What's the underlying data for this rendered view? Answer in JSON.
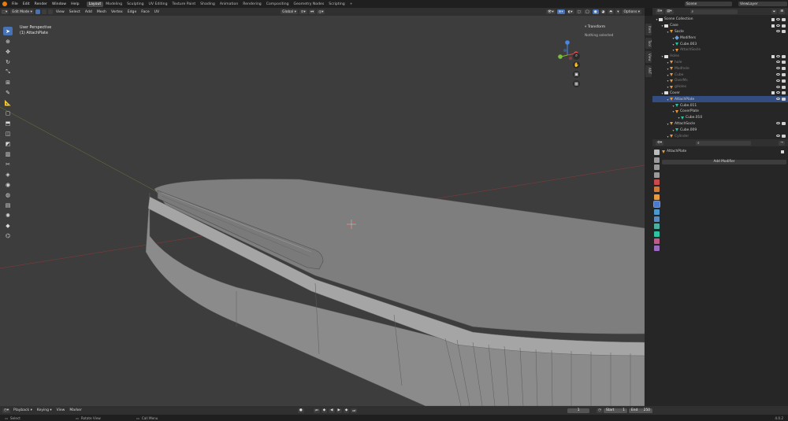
{
  "topmenu": {
    "items": [
      "File",
      "Edit",
      "Render",
      "Window",
      "Help"
    ],
    "workspaces": [
      "Layout",
      "Modeling",
      "Sculpting",
      "UV Editing",
      "Texture Paint",
      "Shading",
      "Animation",
      "Rendering",
      "Compositing",
      "Geometry Nodes",
      "Scripting"
    ],
    "active_workspace": "Layout",
    "add_tab": "+",
    "scene_label": "Scene",
    "viewlayer_label": "ViewLayer"
  },
  "viewport_header": {
    "mode": "Edit Mode",
    "menus": [
      "View",
      "Select",
      "Add",
      "Mesh",
      "Vertex",
      "Edge",
      "Face",
      "UV"
    ],
    "orientation": "Global",
    "options": "Options"
  },
  "viewport": {
    "perspective_label": "User Perspective",
    "object_label": "(1) AttachPlate",
    "transform_header": "Transform",
    "transform_status": "Nothing selected",
    "gizmo_axes": [
      "X",
      "Y",
      "Z"
    ]
  },
  "side_tabs": [
    "Item",
    "Tool",
    "View",
    "ANT"
  ],
  "outliner": {
    "search_placeholder": "",
    "rows": [
      {
        "label": "Scene Collection",
        "indent": 0,
        "icon": "coll",
        "state": "normal"
      },
      {
        "label": "Case",
        "indent": 1,
        "icon": "coll",
        "state": "normal"
      },
      {
        "label": "Socle",
        "indent": 2,
        "icon": "obj",
        "state": "normal"
      },
      {
        "label": "Modifiers",
        "indent": 3,
        "icon": "mod",
        "state": "normal"
      },
      {
        "label": "Cube.003",
        "indent": 3,
        "icon": "mesh",
        "state": "normal"
      },
      {
        "label": "AttachSocle",
        "indent": 3,
        "icon": "obj",
        "state": "dim"
      },
      {
        "label": "Holes",
        "indent": 1,
        "icon": "coll",
        "state": "dim"
      },
      {
        "label": "hole",
        "indent": 2,
        "icon": "obj",
        "state": "dim"
      },
      {
        "label": "Modhole",
        "indent": 2,
        "icon": "obj",
        "state": "dim"
      },
      {
        "label": "Cube",
        "indent": 2,
        "icon": "obj",
        "state": "dim"
      },
      {
        "label": "OverMs",
        "indent": 2,
        "icon": "obj",
        "state": "dim"
      },
      {
        "label": "gHoles",
        "indent": 2,
        "icon": "obj",
        "state": "dim"
      },
      {
        "label": "Cover",
        "indent": 1,
        "icon": "coll",
        "state": "normal"
      },
      {
        "label": "AttachPlate",
        "indent": 2,
        "icon": "obj",
        "state": "selected"
      },
      {
        "label": "Cube.011",
        "indent": 3,
        "icon": "mesh",
        "state": "normal"
      },
      {
        "label": "CoverPlate",
        "indent": 3,
        "icon": "obj",
        "state": "normal"
      },
      {
        "label": "Cube.010",
        "indent": 4,
        "icon": "mesh",
        "state": "normal"
      },
      {
        "label": "AttachSocle",
        "indent": 2,
        "icon": "obj",
        "state": "normal"
      },
      {
        "label": "Cube.009",
        "indent": 3,
        "icon": "mesh",
        "state": "normal"
      },
      {
        "label": "Cylinder",
        "indent": 2,
        "icon": "obj",
        "state": "dim"
      }
    ]
  },
  "properties": {
    "object_name": "AttachPlate",
    "add_modifier_label": "Add Modifier"
  },
  "timeline": {
    "menus": [
      "Playback",
      "Keying",
      "View",
      "Marker"
    ],
    "current_frame": "1",
    "start_label": "Start",
    "start_value": "1",
    "end_label": "End",
    "end_value": "250"
  },
  "statusbar": {
    "select": "Select",
    "rotate": "Rotate View",
    "call_menu": "Call Menu",
    "version": "4.0.2"
  },
  "colors": {
    "accent_blue": "#4772b3",
    "selection_row": "#334d80",
    "object_orange": "#e89a3c",
    "mesh_teal": "#2dc4a3",
    "viewport_bg": "#3d3d3d"
  }
}
